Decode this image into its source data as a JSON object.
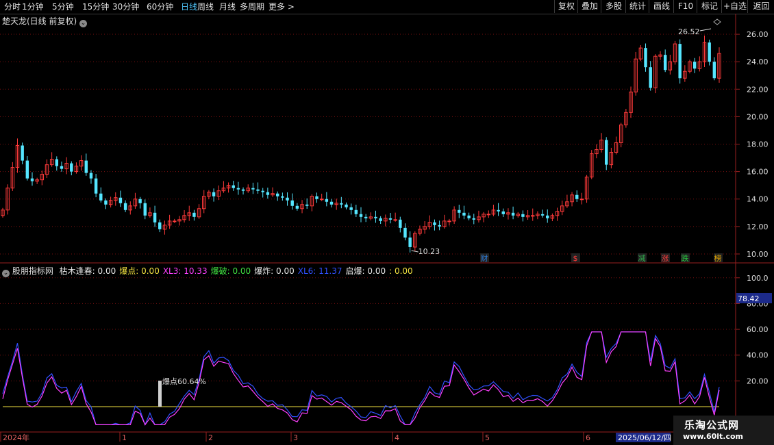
{
  "toolbar": {
    "periods": [
      "分时",
      "1分钟",
      "5分钟",
      "15分钟",
      "30分钟",
      "60分钟",
      "日线",
      "周线",
      "月线",
      "多周期",
      "更多 >"
    ],
    "active_period": "日线",
    "buttons": [
      "复权",
      "叠加",
      "多股",
      "统计",
      "画线",
      "F10",
      "标记",
      "+自选",
      "返回"
    ]
  },
  "main_chart": {
    "title": "楚天龙(日线 前复权)",
    "y_ticks": [
      "26.00",
      "24.00",
      "22.00",
      "20.00",
      "18.00",
      "16.00",
      "14.00",
      "12.00",
      "10.00"
    ],
    "high_annotation": "26.52",
    "low_annotation": "10.23",
    "event_labels": [
      {
        "text": "财",
        "color": "#2b7bd6"
      },
      {
        "text": "$",
        "color": "#ff3a3a"
      },
      {
        "text": "减",
        "color": "#2ea84a"
      },
      {
        "text": "涨",
        "color": "#ff3a3a"
      },
      {
        "text": "跌",
        "color": "#22c33c"
      },
      {
        "text": "榜",
        "color": "#e0a400"
      }
    ]
  },
  "indicator": {
    "name": "股朋指标网",
    "items": [
      {
        "label": "枯木逢春",
        "value": "0.00",
        "color": "#e8e8e8"
      },
      {
        "label": "爆点",
        "value": "0.00",
        "color": "#f0e040"
      },
      {
        "label": "XL3",
        "value": "10.33",
        "color": "#ff40ff"
      },
      {
        "label": "爆破",
        "value": "0.00",
        "color": "#40e040"
      },
      {
        "label": "爆炸",
        "value": "0.00",
        "color": "#e8e8e8"
      },
      {
        "label": "XL6",
        "value": "11.37",
        "color": "#3050ff"
      },
      {
        "label": "启爆",
        "value": "0.00",
        "color": "#e8e8e8"
      },
      {
        "label": "",
        "value": "0.00",
        "color": "#f0e040"
      }
    ],
    "y_ticks": [
      "100.0",
      "80.00",
      "60.00",
      "40.00",
      "20.00"
    ],
    "current_value": "78.42",
    "annotation": "爆点60.64%"
  },
  "x_axis": {
    "labels": [
      "2024年",
      "1",
      "2",
      "3",
      "4",
      "5",
      "6"
    ],
    "cursor_date": "2025/06/12/四"
  },
  "watermark": {
    "title": "乐淘公式网",
    "url": "www.60lt.com"
  },
  "colors": {
    "up": "#ff3a3a",
    "down": "#55e6ff",
    "grid": "#7a1010",
    "xl3": "#ff40ff",
    "xl6": "#3050ff"
  },
  "chart_data": {
    "type": "candlestick",
    "y_range": [
      9.5,
      27
    ],
    "closes": [
      13.2,
      14.8,
      16.3,
      17.9,
      16.8,
      15.5,
      15.3,
      15.4,
      15.8,
      16.5,
      16.9,
      16.4,
      16.2,
      16.6,
      16.0,
      16.4,
      16.8,
      15.9,
      15.5,
      14.4,
      13.9,
      13.6,
      13.9,
      14.1,
      13.7,
      13.2,
      13.5,
      14.0,
      13.7,
      12.8,
      13.0,
      12.3,
      11.8,
      12.1,
      12.4,
      12.4,
      12.5,
      12.8,
      13.0,
      12.7,
      13.3,
      14.2,
      14.5,
      14.2,
      14.6,
      14.8,
      15.0,
      14.8,
      14.7,
      14.6,
      14.8,
      14.7,
      14.6,
      14.5,
      14.3,
      14.4,
      14.2,
      14.1,
      13.9,
      13.5,
      13.3,
      13.6,
      13.5,
      14.2,
      14.0,
      14.0,
      13.8,
      13.6,
      13.7,
      13.6,
      13.4,
      13.2,
      12.9,
      12.7,
      12.6,
      12.7,
      12.6,
      12.4,
      12.6,
      12.5,
      12.5,
      11.9,
      11.2,
      10.5,
      11.5,
      11.8,
      12.0,
      12.3,
      12.1,
      12.0,
      12.4,
      12.4,
      13.2,
      13.0,
      12.8,
      12.6,
      12.5,
      12.7,
      12.9,
      12.9,
      13.2,
      13.1,
      12.9,
      13.0,
      12.8,
      12.9,
      12.7,
      12.8,
      12.8,
      12.9,
      12.8,
      12.6,
      12.8,
      13.1,
      13.5,
      13.8,
      14.3,
      14.0,
      14.0,
      15.6,
      17.3,
      17.6,
      18.3,
      16.5,
      17.4,
      18.1,
      19.4,
      20.3,
      21.8,
      24.2,
      25.0,
      23.6,
      22.1,
      24.4,
      24.5,
      23.4,
      24.0,
      25.3,
      22.8,
      23.3,
      24.0,
      23.5,
      24.0,
      25.4,
      24.0,
      22.8,
      24.6
    ],
    "ohlc_rule": "open = previous close"
  }
}
